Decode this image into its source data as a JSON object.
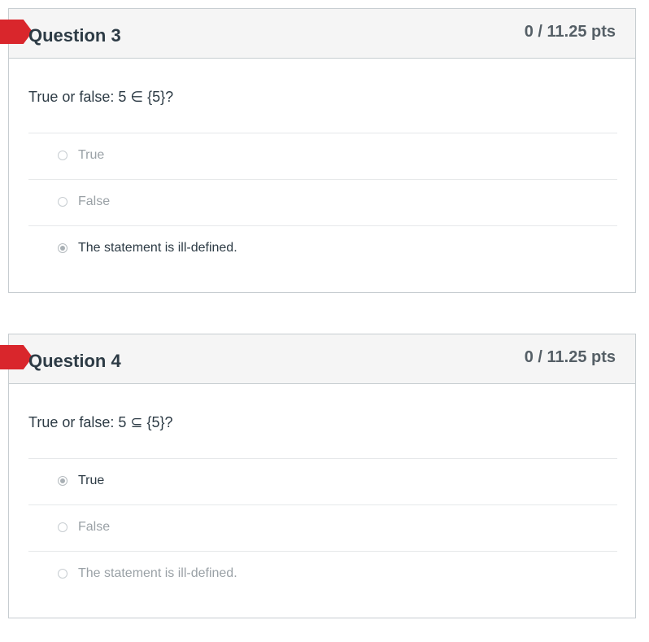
{
  "questions": [
    {
      "title": "Question 3",
      "points": "0 / 11.25 pts",
      "text": "True or false: 5 ∈ {5}?",
      "answers": [
        {
          "label": "True",
          "selected": false
        },
        {
          "label": "False",
          "selected": false
        },
        {
          "label": "The statement is ill-defined.",
          "selected": true
        }
      ]
    },
    {
      "title": "Question 4",
      "points": "0 / 11.25 pts",
      "text": "True or false: 5 ⊆ {5}?",
      "answers": [
        {
          "label": "True",
          "selected": true
        },
        {
          "label": "False",
          "selected": false
        },
        {
          "label": "The statement is ill-defined.",
          "selected": false
        }
      ]
    }
  ],
  "colors": {
    "flag": "#d9262c",
    "header_bg": "#f5f5f5",
    "border": "#c7cdd1",
    "text": "#2d3b45",
    "muted_text": "#9aa1a6"
  },
  "icons": {
    "flag": "flag-icon",
    "radio": "radio-button"
  }
}
